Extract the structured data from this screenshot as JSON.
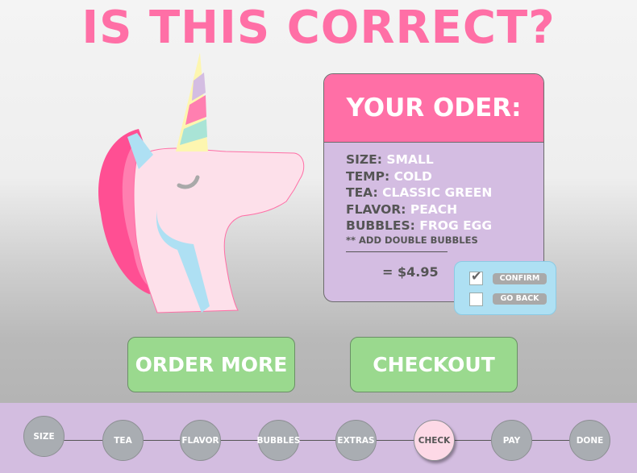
{
  "title": "IS THIS CORRECT?",
  "order": {
    "header": "YOUR ODER:",
    "lines": [
      {
        "label": "SIZE:",
        "value": "SMALL"
      },
      {
        "label": "TEMP:",
        "value": "COLD"
      },
      {
        "label": "TEA:",
        "value": "CLASSIC GREEN"
      },
      {
        "label": "FLAVOR:",
        "value": "PEACH"
      },
      {
        "label": "BUBBLES:",
        "value": "FROG EGG"
      }
    ],
    "note": "** ADD DOUBLE BUBBLES",
    "total": "= $4.95"
  },
  "confirm": {
    "confirm_label": "CONFIRM",
    "back_label": "GO BACK",
    "confirm_checked": true,
    "back_checked": false
  },
  "buttons": {
    "order_more": "ORDER MORE",
    "checkout": "CHECKOUT"
  },
  "steps": {
    "items": [
      "SIZE",
      "TEA",
      "FLAVOR",
      "BUBBLES",
      "EXTRAS",
      "CHECK",
      "PAY",
      "DONE"
    ],
    "current_index": 5
  },
  "colors": {
    "accent_pink": "#ff6fa6",
    "lavender": "#d4bde2",
    "green": "#9ad98e",
    "light_blue": "#aee0f3"
  },
  "icons": [
    "unicorn-illustration",
    "checkbox-icon"
  ]
}
